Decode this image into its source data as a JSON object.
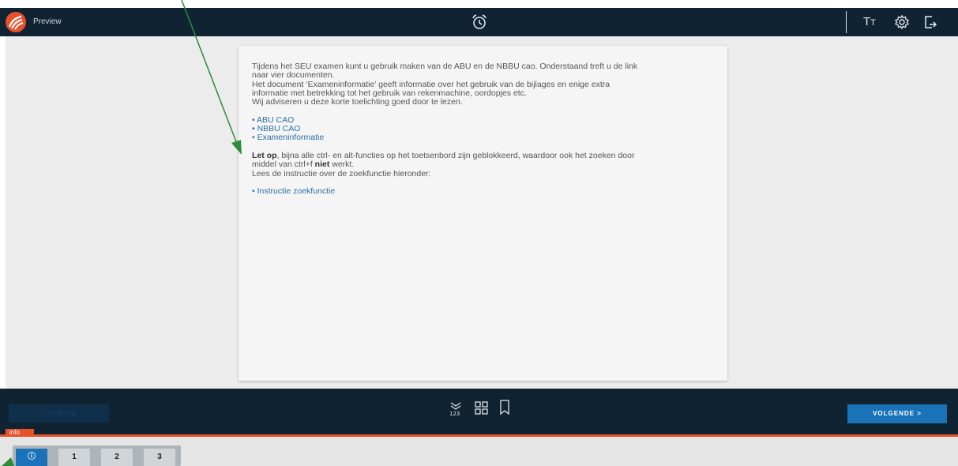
{
  "header": {
    "app_label": "Preview",
    "text_size_label_big": "T",
    "text_size_label_small": "T"
  },
  "content": {
    "intro_lines": [
      "Tijdens het SEU examen kunt u gebruik maken van de ABU en de NBBU cao. Onderstaand treft u de link",
      "naar vier documenten.",
      "Het document ‘Exameninformatie’ geeft informatie over het gebruik van de bijlages en enige extra",
      "informatie met betrekking tot het gebruik van rekenmachine, oordopjes etc.",
      "Wij adviseren u deze korte toelichting goed door te lezen."
    ],
    "links": [
      "• ABU CAO",
      "• NBBU CAO",
      "• Exameninformatie"
    ],
    "warning_bold": "Let op",
    "warning_rest_1": ", bijna alle ctrl- en alt-functies op het toetsenbord zijn geblokkeerd, waardoor ook het zoeken door",
    "warning_line_2_pre": "middel van ctrl+f ",
    "warning_line_2_bold": "niet",
    "warning_line_2_post": " werkt.",
    "instruction_line": "Lees de instructie over de zoekfunctie hieronder:",
    "search_link": "• Instructie zoekfunctie"
  },
  "footer": {
    "prev_label": "< VORIGE",
    "next_label": "VOLGENDE  >",
    "info_tag": "info"
  },
  "question_nav": {
    "items": [
      "ⓘ",
      "1",
      "2",
      "3"
    ],
    "active_index": 0
  },
  "colors": {
    "navy": "#0f2333",
    "accent": "#e8502a",
    "primary": "#1a73b8",
    "link": "#2b6fa6",
    "annotation_arrow": "#2e8b3a"
  }
}
